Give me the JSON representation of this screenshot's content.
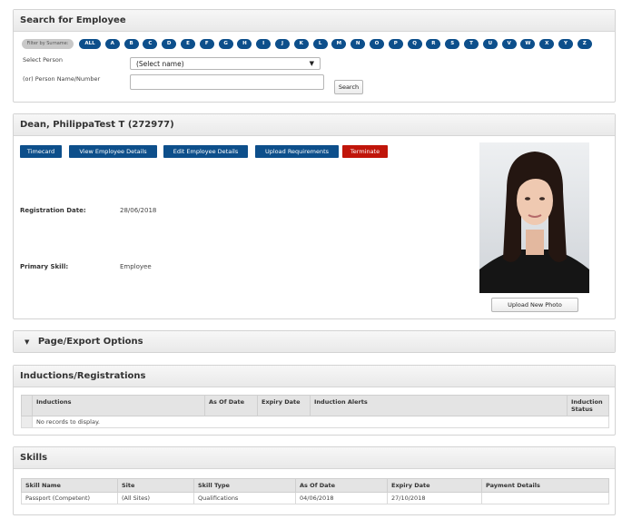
{
  "search": {
    "title": "Search for Employee",
    "filter_label": "Filter by Surname:",
    "letters": [
      "ALL",
      "A",
      "B",
      "C",
      "D",
      "E",
      "F",
      "G",
      "H",
      "I",
      "J",
      "K",
      "L",
      "M",
      "N",
      "O",
      "P",
      "Q",
      "R",
      "S",
      "T",
      "U",
      "V",
      "W",
      "X",
      "Y",
      "Z"
    ],
    "select_person_label": "Select Person",
    "select_value": "(Select name)",
    "name_number_label": "(or) Person Name/Number",
    "name_number_value": "",
    "search_button": "Search"
  },
  "employee": {
    "title": "Dean, PhilippaTest T (272977)",
    "buttons": [
      "Timecard",
      "View Employee Details",
      "Edit Employee Details",
      "Upload Requirements",
      "Terminate"
    ],
    "registration_date_label": "Registration Date:",
    "registration_date_value": "28/06/2018",
    "primary_skill_label": "Primary Skill:",
    "primary_skill_value": "Employee",
    "upload_photo_button": "Upload New Photo"
  },
  "export": {
    "title": "Page/Export Options"
  },
  "inductions": {
    "title": "Inductions/Registrations",
    "columns": [
      "Inductions",
      "As Of Date",
      "Expiry Date",
      "Induction Alerts",
      "Induction Status"
    ],
    "empty_message": "No records to display."
  },
  "skills": {
    "title": "Skills",
    "columns": [
      "Skill Name",
      "Site",
      "Skill Type",
      "As Of Date",
      "Expiry Date",
      "Payment Details"
    ],
    "rows": [
      [
        "Passport (Competent)",
        "(All Sites)",
        "Qualifications",
        "04/06/2018",
        "27/10/2018",
        ""
      ]
    ]
  },
  "colors": {
    "primary": "#0d4f8b",
    "danger": "#c0150a"
  }
}
